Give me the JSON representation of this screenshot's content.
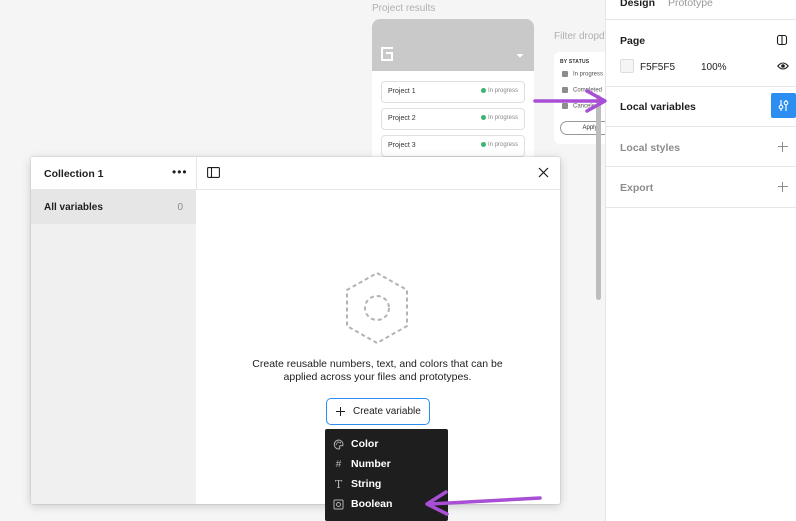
{
  "canvas": {
    "frame_label": "Project results",
    "filter_label": "Filter dropdo",
    "projects": [
      {
        "name": "Project 1",
        "status": "In progress"
      },
      {
        "name": "Project 2",
        "status": "In progress"
      },
      {
        "name": "Project 3",
        "status": "In progress"
      }
    ],
    "filter": {
      "heading": "BY STATUS",
      "options": [
        "In progress",
        "Completed",
        "Canceled"
      ],
      "apply_label": "Apply"
    }
  },
  "design_panel": {
    "tabs": [
      "Design",
      "Prototype"
    ],
    "page": {
      "title": "Page",
      "color_hex": "F5F5F5",
      "opacity": "100%"
    },
    "local_variables": "Local variables",
    "local_styles": "Local styles",
    "export": "Export"
  },
  "collection_modal": {
    "title": "Collection 1",
    "all_variables_label": "All variables",
    "all_variables_count": "0",
    "empty_text_line1": "Create reusable numbers, text, and colors that can be",
    "empty_text_line2": "applied across your files and prototypes.",
    "create_button": "Create variable"
  },
  "type_menu": {
    "items": [
      {
        "label": "Color",
        "icon": "palette-icon"
      },
      {
        "label": "Number",
        "icon": "hash-icon"
      },
      {
        "label": "String",
        "icon": "text-icon"
      },
      {
        "label": "Boolean",
        "icon": "toggle-icon"
      }
    ]
  },
  "colors": {
    "accent": "#2b8ef0",
    "annotation": "#a84fd6",
    "menu_bg": "#1e1e1e",
    "status_green": "#3cb371"
  }
}
